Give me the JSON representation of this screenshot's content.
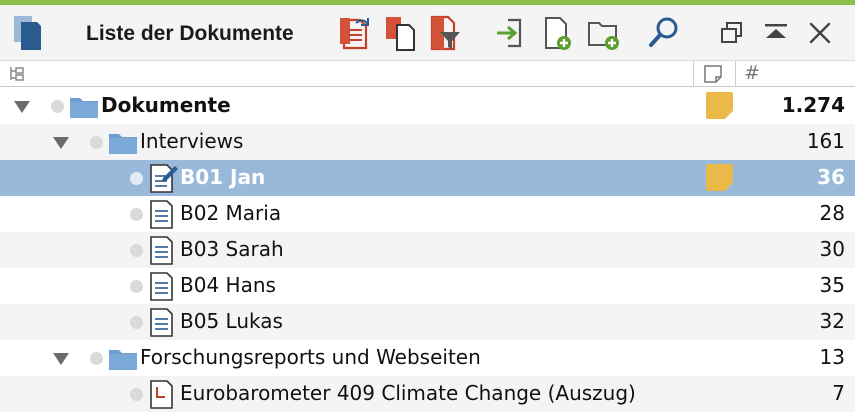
{
  "window": {
    "title": "Liste der Dokumente"
  },
  "toolbar": {
    "buttons": [
      {
        "icon": "documents-panel-icon"
      },
      {
        "icon": "undo-activation-icon"
      },
      {
        "icon": "copy-documents-icon"
      },
      {
        "icon": "filter-documents-icon"
      },
      {
        "icon": "import-icon"
      },
      {
        "icon": "new-document-icon"
      },
      {
        "icon": "new-folder-icon"
      },
      {
        "icon": "search-icon"
      },
      {
        "icon": "undock-window-icon"
      },
      {
        "icon": "collapse-all-icon"
      },
      {
        "icon": "close-icon"
      }
    ]
  },
  "columns": {
    "tree": "tree-icon",
    "memo": "memo-column-icon",
    "count": "#"
  },
  "colors": {
    "accent_bar": "#8cc04b",
    "selection": "#98b9d9",
    "memo": "#eab94a",
    "folder": "#6f9fd0"
  },
  "rows": [
    {
      "label": "Dokumente",
      "count": "1.274",
      "bold": true,
      "memo": true,
      "kind": "folder"
    },
    {
      "label": "Interviews",
      "count": "161",
      "bold": false,
      "memo": false,
      "kind": "folder"
    },
    {
      "label": "B01 Jan",
      "count": "36",
      "bold": true,
      "memo": true,
      "kind": "doc-edit",
      "selected": true
    },
    {
      "label": "B02 Maria",
      "count": "28",
      "kind": "doc"
    },
    {
      "label": "B03 Sarah",
      "count": "30",
      "kind": "doc"
    },
    {
      "label": "B04 Hans",
      "count": "35",
      "kind": "doc"
    },
    {
      "label": "B05 Lukas",
      "count": "32",
      "kind": "doc"
    },
    {
      "label": "Forschungsreports und Webseiten",
      "count": "13",
      "kind": "folder"
    },
    {
      "label": "Eurobarometer 409 Climate Change (Auszug)",
      "count": "7",
      "kind": "pdf"
    }
  ]
}
